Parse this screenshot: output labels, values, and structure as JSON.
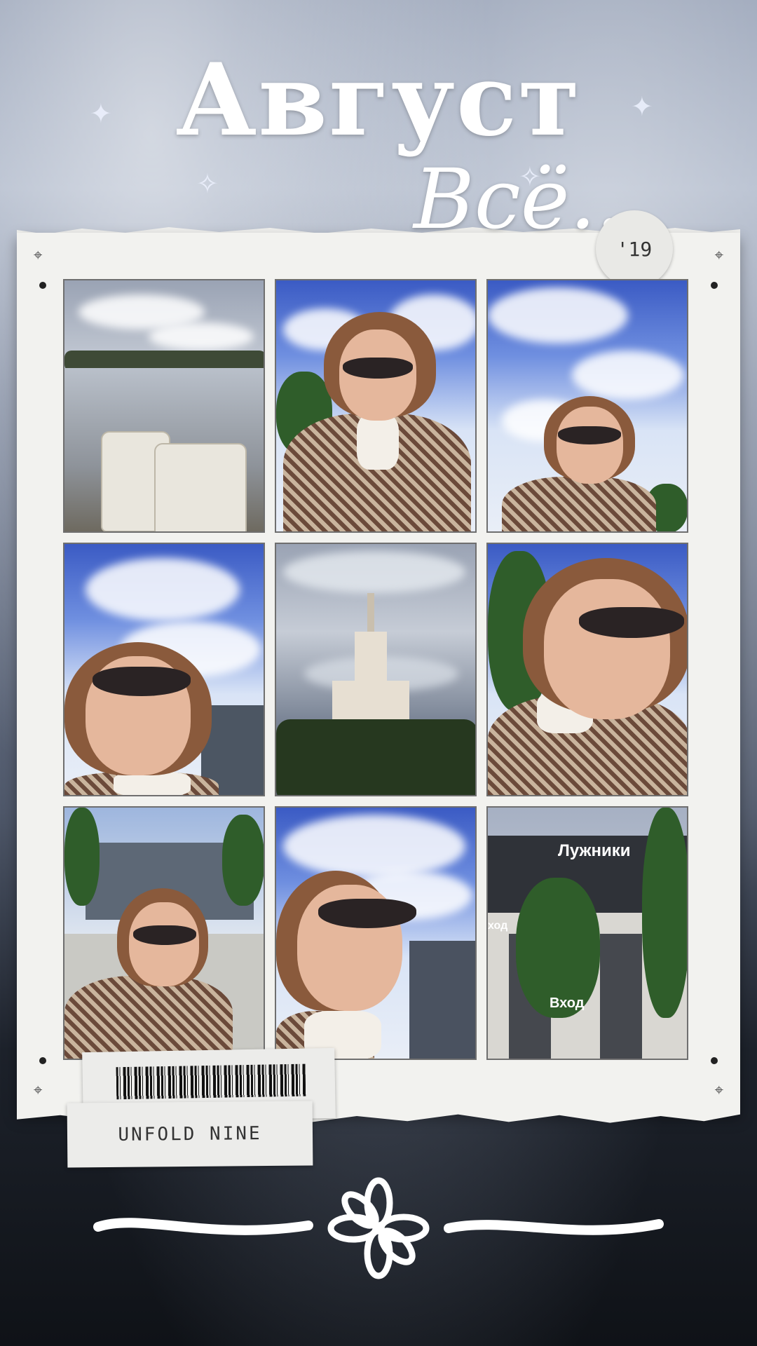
{
  "title": "Август",
  "subtitle": "Всё...",
  "year_badge": "'19",
  "label": "UNFOLD NINE",
  "photos": [
    {
      "name": "photo-fountain-coffee"
    },
    {
      "name": "photo-selfie-1"
    },
    {
      "name": "photo-selfie-2"
    },
    {
      "name": "photo-selfie-3"
    },
    {
      "name": "photo-tower"
    },
    {
      "name": "photo-selfie-4"
    },
    {
      "name": "photo-selfie-5"
    },
    {
      "name": "photo-selfie-6"
    },
    {
      "name": "photo-luzhniki"
    }
  ],
  "signs": {
    "luzhniki": "Лужники",
    "entrance": "Вход",
    "exit_fragment": "ход"
  },
  "icons": [
    "sparkle-icon",
    "crosshair-icon",
    "flower-doodle-icon"
  ],
  "colors": {
    "frame": "#f2f2ef",
    "text": "#ffffff"
  }
}
